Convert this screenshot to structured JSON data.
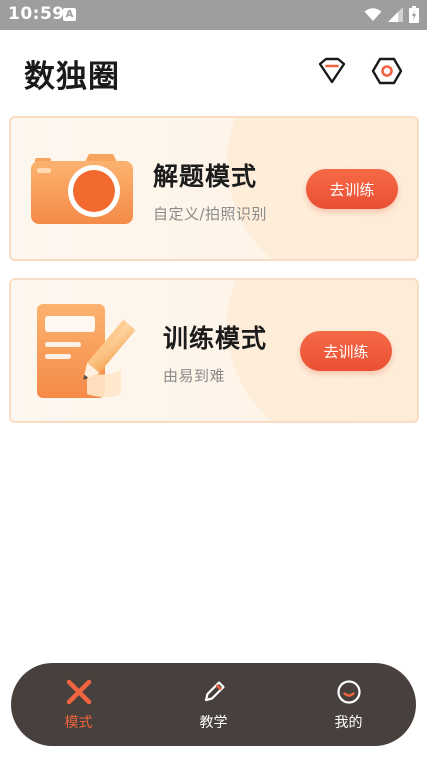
{
  "status_bar": {
    "time": "10:59",
    "app_icon_letter": "A"
  },
  "header": {
    "title": "数独圈",
    "icons": [
      "diamond-icon",
      "settings-icon"
    ]
  },
  "cards": [
    {
      "title": "解题模式",
      "subtitle": "自定义/拍照识别",
      "button_label": "去训练",
      "icon": "camera-icon"
    },
    {
      "title": "训练模式",
      "subtitle": "由易到难",
      "button_label": "去训练",
      "icon": "notepad-pencil-icon"
    }
  ],
  "bottom_nav": {
    "items": [
      {
        "label": "模式",
        "icon": "mode-icon",
        "active": true
      },
      {
        "label": "教学",
        "icon": "pencil-icon",
        "active": false
      },
      {
        "label": "我的",
        "icon": "profile-icon",
        "active": false
      }
    ]
  },
  "colors": {
    "accent": "#f0643f",
    "button": "#ec5538",
    "card_border": "#f8dcc3",
    "nav_bg": "#47403d",
    "status_bar": "#9e9e9e"
  }
}
